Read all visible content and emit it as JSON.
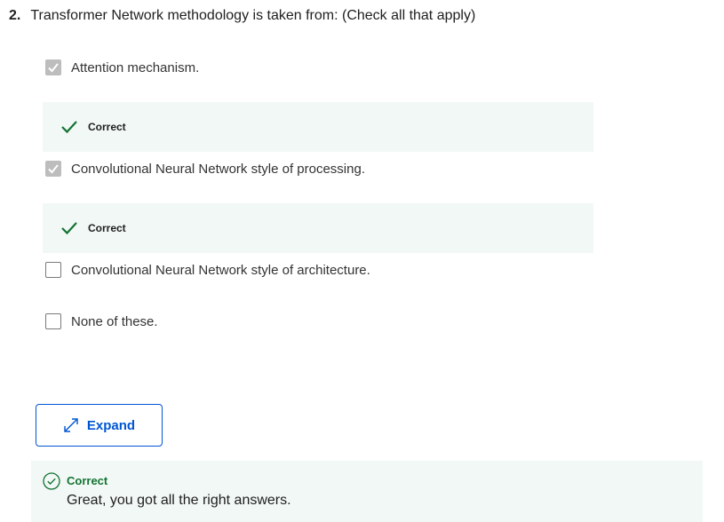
{
  "question": {
    "number": "2.",
    "text": "Transformer Network methodology is taken from: (Check all that apply)"
  },
  "options": [
    {
      "label": "Attention mechanism.",
      "checked": true,
      "feedback": "Correct"
    },
    {
      "label": "Convolutional Neural Network style of processing.",
      "checked": true,
      "feedback": "Correct"
    },
    {
      "label": "Convolutional Neural Network style of architecture.",
      "checked": false
    },
    {
      "label": "None of these.",
      "checked": false
    }
  ],
  "expand_button": {
    "label": "Expand",
    "icon": "expand-arrows-icon"
  },
  "result": {
    "title": "Correct",
    "message": "Great, you got all the right answers.",
    "icon": "check-circle-icon"
  },
  "colors": {
    "correct_green": "#137333",
    "feedback_bg": "#f2f8f5",
    "link_blue": "#0056d2",
    "checked_gray": "#bdbdbd"
  }
}
